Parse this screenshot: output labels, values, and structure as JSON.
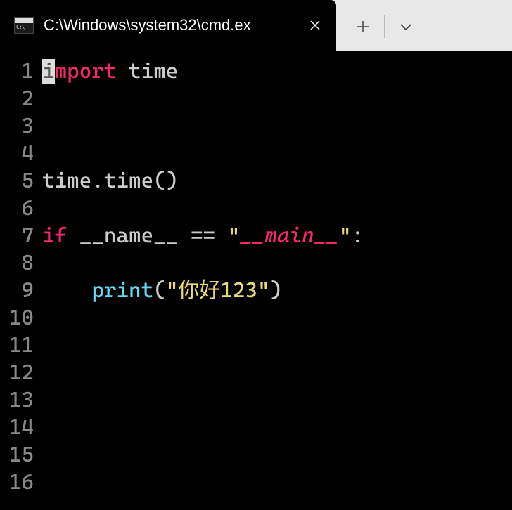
{
  "tab": {
    "title": "C:\\Windows\\system32\\cmd.ex"
  },
  "gutter": {
    "l1": "1",
    "l2": "2",
    "l3": "3",
    "l4": "4",
    "l5": "5",
    "l6": "6",
    "l7": "7",
    "l8": "8",
    "l9": "9",
    "l10": "10",
    "l11": "11",
    "l12": "12",
    "l13": "13",
    "l14": "14",
    "l15": "15",
    "l16": "16"
  },
  "code": {
    "line1": {
      "cursor": "i",
      "keyword": "mport",
      "sp": " ",
      "module": "time"
    },
    "line5": {
      "obj": "time",
      "dot": ".",
      "method": "time",
      "paren": "()"
    },
    "line7": {
      "kw_if": "if",
      "sp1": " ",
      "dunder": "__name__",
      "sp2": " ",
      "eq": "==",
      "sp3": " ",
      "q1": "\"",
      "str": "__main__",
      "q2": "\"",
      "colon": ":"
    },
    "line9": {
      "indent": "    ",
      "builtin": "print",
      "open": "(",
      "q1": "\"",
      "str": "你好123",
      "q2": "\"",
      "close": ")"
    }
  }
}
